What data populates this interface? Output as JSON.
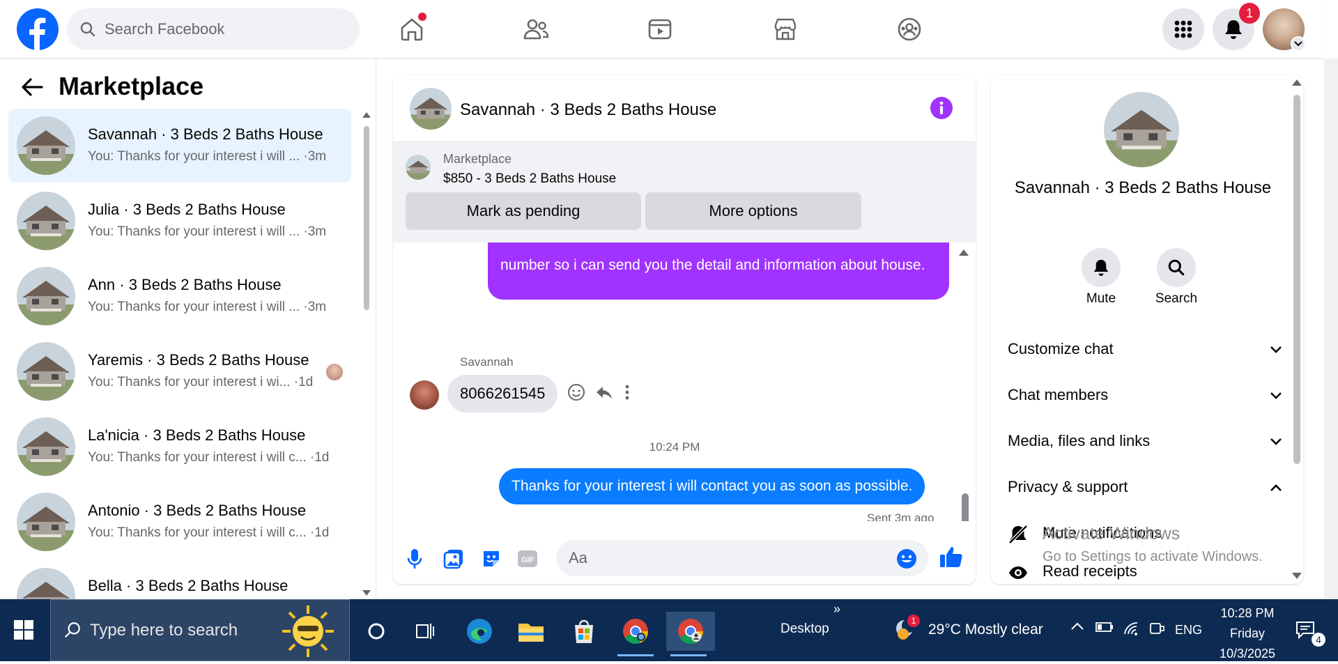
{
  "header": {
    "search_placeholder": "Search Facebook",
    "notification_count": "1",
    "nav_icons": [
      "home-icon",
      "friends-icon",
      "watch-icon",
      "marketplace-icon",
      "groups-icon"
    ],
    "badge_color": "#e41e3f",
    "brand_color": "#0866ff"
  },
  "sidebar": {
    "title": "Marketplace",
    "conversations": [
      {
        "name": "Savannah · 3 Beds 2 Baths House",
        "preview": "You: Thanks for your interest i will ... ·3m"
      },
      {
        "name": "Julia · 3 Beds 2 Baths House",
        "preview": "You: Thanks for your interest i will ... ·3m"
      },
      {
        "name": "Ann · 3 Beds 2 Baths House",
        "preview": "You: Thanks for your interest i will ... ·3m"
      },
      {
        "name": "Yaremis · 3 Beds 2 Baths House",
        "preview": "You: Thanks for your interest i wi... ·1d"
      },
      {
        "name": "La'nicia · 3 Beds 2 Baths House",
        "preview": "You: Thanks for your interest i will c... ·1d"
      },
      {
        "name": "Antonio · 3 Beds 2 Baths House",
        "preview": "You: Thanks for your interest i will c... ·1d"
      },
      {
        "name": "Bella · 3 Beds 2 Baths House",
        "preview": ""
      }
    ]
  },
  "chat": {
    "title": "Savannah · 3 Beds 2 Baths House",
    "marketplace_label": "Marketplace",
    "listing": "$850 - 3 Beds 2 Baths House",
    "mark_pending": "Mark as pending",
    "more_options": "More options",
    "purple_message": "number so i can send you the detail and information about house.",
    "sender": "Savannah",
    "phone_message": "8066261545",
    "time_separator": "10:24 PM",
    "my_message": "Thanks for your interest i will contact you as soon as possible.",
    "status": "Sent 3m ago",
    "input_placeholder": "Aa",
    "purple_color": "#a033ff",
    "blue_color": "#0a7cff"
  },
  "details": {
    "title": "Savannah · 3 Beds 2 Baths House",
    "mute": "Mute",
    "search": "Search",
    "sections": [
      "Customize chat",
      "Chat members",
      "Media, files and links",
      "Privacy & support"
    ],
    "mute_notifications": "Mute notifications",
    "read_receipts": "Read receipts"
  },
  "watermark": {
    "line1": "Activate Windows",
    "line2": "Go to Settings to activate Windows."
  },
  "taskbar": {
    "search_placeholder": "Type here to search",
    "desktop": "Desktop",
    "more": "»",
    "weather": "29°C  Mostly clear",
    "weather_badge": "1",
    "language": "ENG",
    "time": "10:28 PM",
    "day": "Friday",
    "date": "10/3/2025",
    "notification_count": "4"
  }
}
